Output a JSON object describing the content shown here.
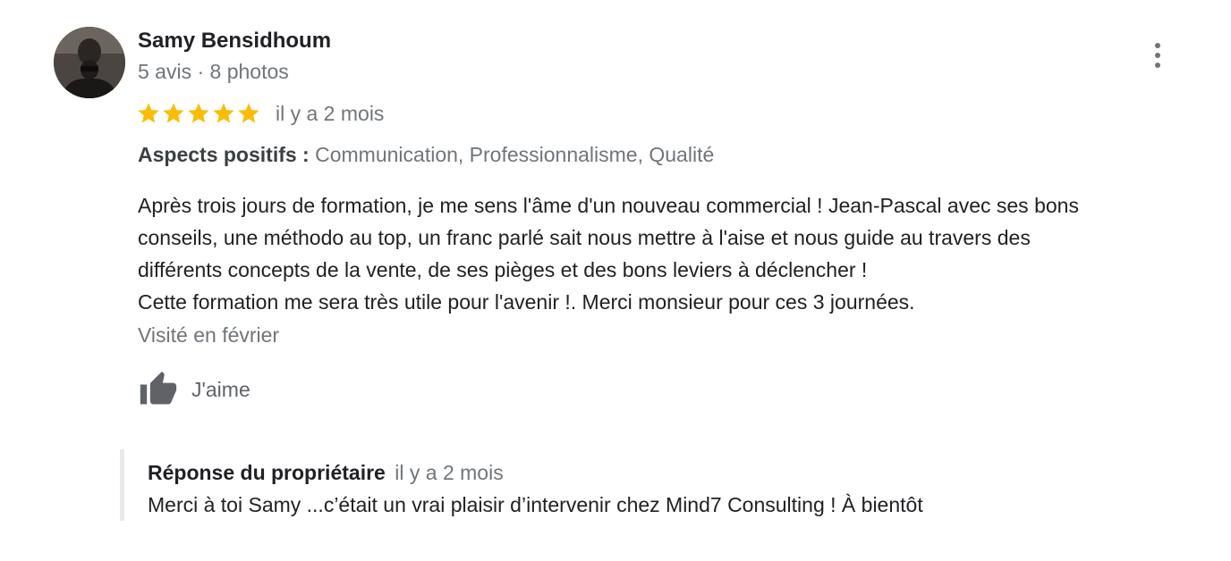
{
  "review": {
    "author": {
      "name": "Samy Bensidhoum",
      "meta": "5 avis · 8 photos"
    },
    "rating": 5,
    "rating_max": 5,
    "star_color": "#fbbc04",
    "date": "il y a 2 mois",
    "aspects": {
      "label": "Aspects positifs :",
      "values": "Communication, Professionnalisme, Qualité"
    },
    "text_lines": [
      "Après trois jours de formation, je me sens l'âme d'un nouveau commercial ! Jean-Pascal avec ses bons",
      "conseils, une méthodo au top, un franc parlé sait nous mettre à l'aise et nous guide au travers des",
      "différents concepts de la vente, de ses pièges et des bons leviers à déclencher !",
      "Cette formation me sera très utile pour l'avenir !. Merci monsieur pour ces 3 journées."
    ],
    "visited": "Visité en février",
    "like_label": "J'aime",
    "more_icon": "more-vert-icon",
    "like_icon": "thumb-up-icon"
  },
  "owner_reply": {
    "title": "Réponse du propriétaire",
    "date": "il y a 2 mois",
    "text": "Merci à toi Samy ...c’était un vrai plaisir d’intervenir chez Mind7 Consulting ! À bientôt"
  }
}
